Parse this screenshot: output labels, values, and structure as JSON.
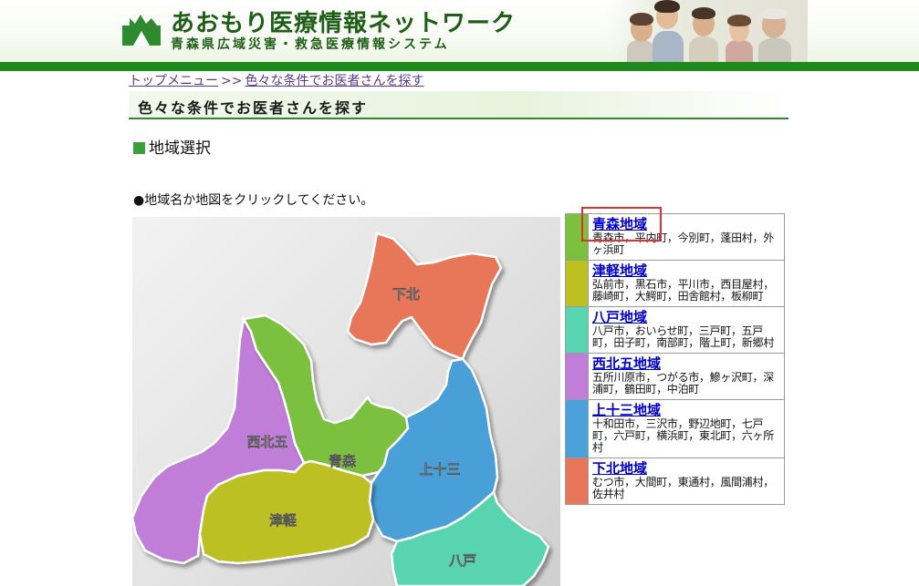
{
  "header": {
    "title": "あおもり医療情報ネットワーク",
    "subtitle": "青森県広域災害・救急医療情報システム",
    "brand_color": "#1e8a1e",
    "logo_icon": "aomori-prefecture-logo-icon",
    "photo_icon": "family-photo-icon"
  },
  "breadcrumb": {
    "items": [
      "トップメニュー",
      "色々な条件でお医者さんを探す"
    ],
    "separator": ">>"
  },
  "section": {
    "title": "色々な条件でお医者さんを探す",
    "sub_heading": "地域選択",
    "instruction": "●地域名か地図をクリックしてください。"
  },
  "map": {
    "labels": {
      "shimokita": "下北",
      "nishikitago": "西北五",
      "aomori": "青森",
      "kamitosan": "上十三",
      "tsugaru": "津軽",
      "hachinohe": "八戸"
    },
    "colors": {
      "shimokita": "#e8775a",
      "nishikitago": "#c07ed8",
      "aomori": "#7cc040",
      "kamitosan": "#4aa0d8",
      "tsugaru": "#bcc020",
      "hachinohe": "#58d4b0"
    }
  },
  "regions": [
    {
      "name": "青森地域",
      "towns": "青森市，平内町，今別町，蓬田村，外ヶ浜町",
      "color": "#7cc040"
    },
    {
      "name": "津軽地域",
      "towns": "弘前市，黒石市，平川市，西目屋村，藤崎町，大鰐町，田舎館村，板柳町",
      "color": "#bcc020"
    },
    {
      "name": "八戸地域",
      "towns": "八戸市，おいらせ町，三戸町，五戸町，田子町，南部町，階上町，新郷村",
      "color": "#58d4b0"
    },
    {
      "name": "西北五地域",
      "towns": "五所川原市，つがる市，鰺ヶ沢町，深浦町，鶴田町，中泊町",
      "color": "#c07ed8"
    },
    {
      "name": "上十三地域",
      "towns": "十和田市，三沢市，野辺地町，七戸町，六戸町，横浜町，東北町，六ヶ所村",
      "color": "#4aa0d8"
    },
    {
      "name": "下北地域",
      "towns": "むつ市，大間町，東通村，風間浦村，佐井村",
      "color": "#e8775a"
    }
  ]
}
